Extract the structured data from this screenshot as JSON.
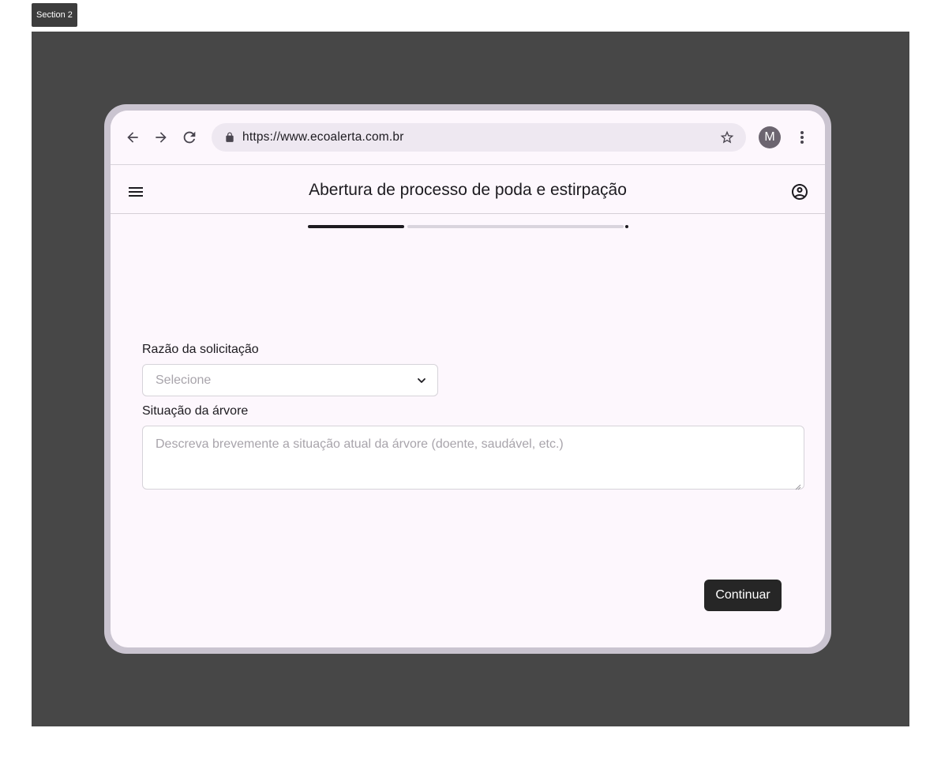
{
  "section": {
    "label": "Section 2"
  },
  "browser": {
    "url": "https://www.ecoalerta.com.br",
    "profile_initial": "M",
    "icons": [
      "back-arrow-icon",
      "forward-arrow-icon",
      "reload-icon",
      "lock-icon",
      "star-icon",
      "more-vert-icon"
    ]
  },
  "app_bar": {
    "title": "Abertura de processo de poda e estirpação",
    "icons": [
      "menu-icon",
      "account-circle-icon"
    ]
  },
  "progress": {
    "value": 0.3,
    "steps_total": 2
  },
  "form": {
    "reason": {
      "label": "Razão da solicitação",
      "placeholder": "Selecione"
    },
    "tree_situation": {
      "label": "Situação da árvore",
      "placeholder": "Descreva brevemente a situação atual da árvore (doente, saudável, etc.)"
    },
    "continue_label": "Continuar"
  },
  "colors": {
    "canvas": "#474747",
    "device_frame": "#cac4d0",
    "surface": "#fdf7fd",
    "primary_button": "#262626"
  }
}
